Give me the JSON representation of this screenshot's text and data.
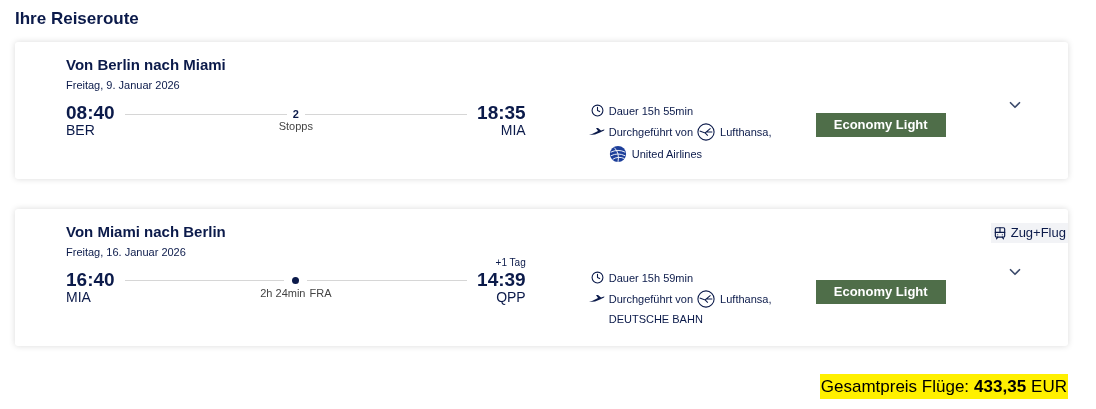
{
  "heading": "Ihre Reiseroute",
  "segments": [
    {
      "title": "Von Berlin nach Miami",
      "date": "Freitag, 9. Januar 2026",
      "departure": {
        "time": "08:40",
        "code": "BER"
      },
      "arrival": {
        "time": "18:35",
        "code": "MIA"
      },
      "middle": {
        "kind": "stops",
        "count": "2",
        "label": "Stopps"
      },
      "duration": "Dauer 15h 55min",
      "operated_label": "Durchgeführt von",
      "operators": [
        {
          "kind": "crane",
          "name": "Lufthansa,"
        },
        {
          "kind": "globe",
          "name": "United Airlines"
        }
      ],
      "fare": "Economy Light"
    },
    {
      "title": "Von Miami nach Berlin",
      "date": "Freitag, 16. Januar 2026",
      "departure": {
        "time": "16:40",
        "code": "MIA"
      },
      "arrival": {
        "time": "14:39",
        "code": "QPP",
        "day_offset": "+1 Tag"
      },
      "middle": {
        "kind": "layover",
        "duration": "2h 24min",
        "airport": "FRA"
      },
      "duration": "Dauer 15h 59min",
      "operated_label": "Durchgeführt von",
      "operators": [
        {
          "kind": "crane",
          "name": "Lufthansa,"
        },
        {
          "kind": "text",
          "name": "DEUTSCHE BAHN"
        }
      ],
      "fare": "Economy Light",
      "tag": "Zug+Flug"
    }
  ],
  "total": {
    "label": "Gesamtpreis Flüge:",
    "amount": "433,35",
    "currency": "EUR"
  }
}
